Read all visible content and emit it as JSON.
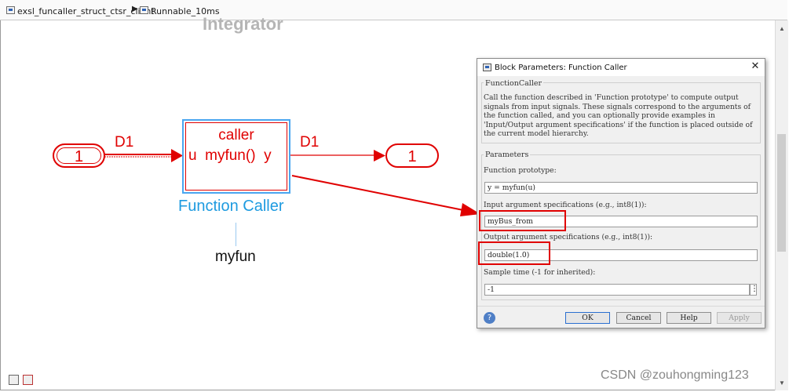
{
  "breadcrumb": {
    "items": [
      {
        "label": "exsl_funcaller_struct_ctsr_client",
        "icon": "model-icon"
      },
      {
        "label": "Runnable_10ms",
        "icon": "subsystem-icon"
      }
    ],
    "separator": "▶"
  },
  "diagram": {
    "background_title": "Integrator",
    "inport": {
      "number": "1"
    },
    "outport": {
      "number": "1"
    },
    "input_signal": "D1",
    "output_signal": "D1",
    "block": {
      "caller_text": "caller",
      "signature": "u  myfun()  y",
      "name": "Function Caller",
      "function_label": "myfun"
    },
    "colors": {
      "signal": "#e00000",
      "block_selection": "#4aa6f0",
      "block_name": "#1e9be0"
    }
  },
  "dialog": {
    "title": "Block Parameters: Function Caller",
    "description_group": "FunctionCaller",
    "description": "Call the function described in 'Function prototype' to compute output signals from input signals. These signals correspond to the arguments of the function called, and you can optionally provide examples in 'Input/Output argument specifications' if the function is placed outside of the current model hierarchy.",
    "parameters_group": "Parameters",
    "function_prototype_label": "Function prototype:",
    "function_prototype_value": "y = myfun(u)",
    "input_spec_label": "Input argument specifications (e.g., int8(1)):",
    "input_spec_value": "myBus_from",
    "output_spec_label": "Output argument specifications (e.g., int8(1)):",
    "output_spec_value": "double(1.0)",
    "sample_time_label": "Sample time (-1 for inherited):",
    "sample_time_value": "-1",
    "buttons": {
      "ok": "OK",
      "cancel": "Cancel",
      "help": "Help",
      "apply": "Apply"
    }
  },
  "watermark": "CSDN @zouhongming123"
}
